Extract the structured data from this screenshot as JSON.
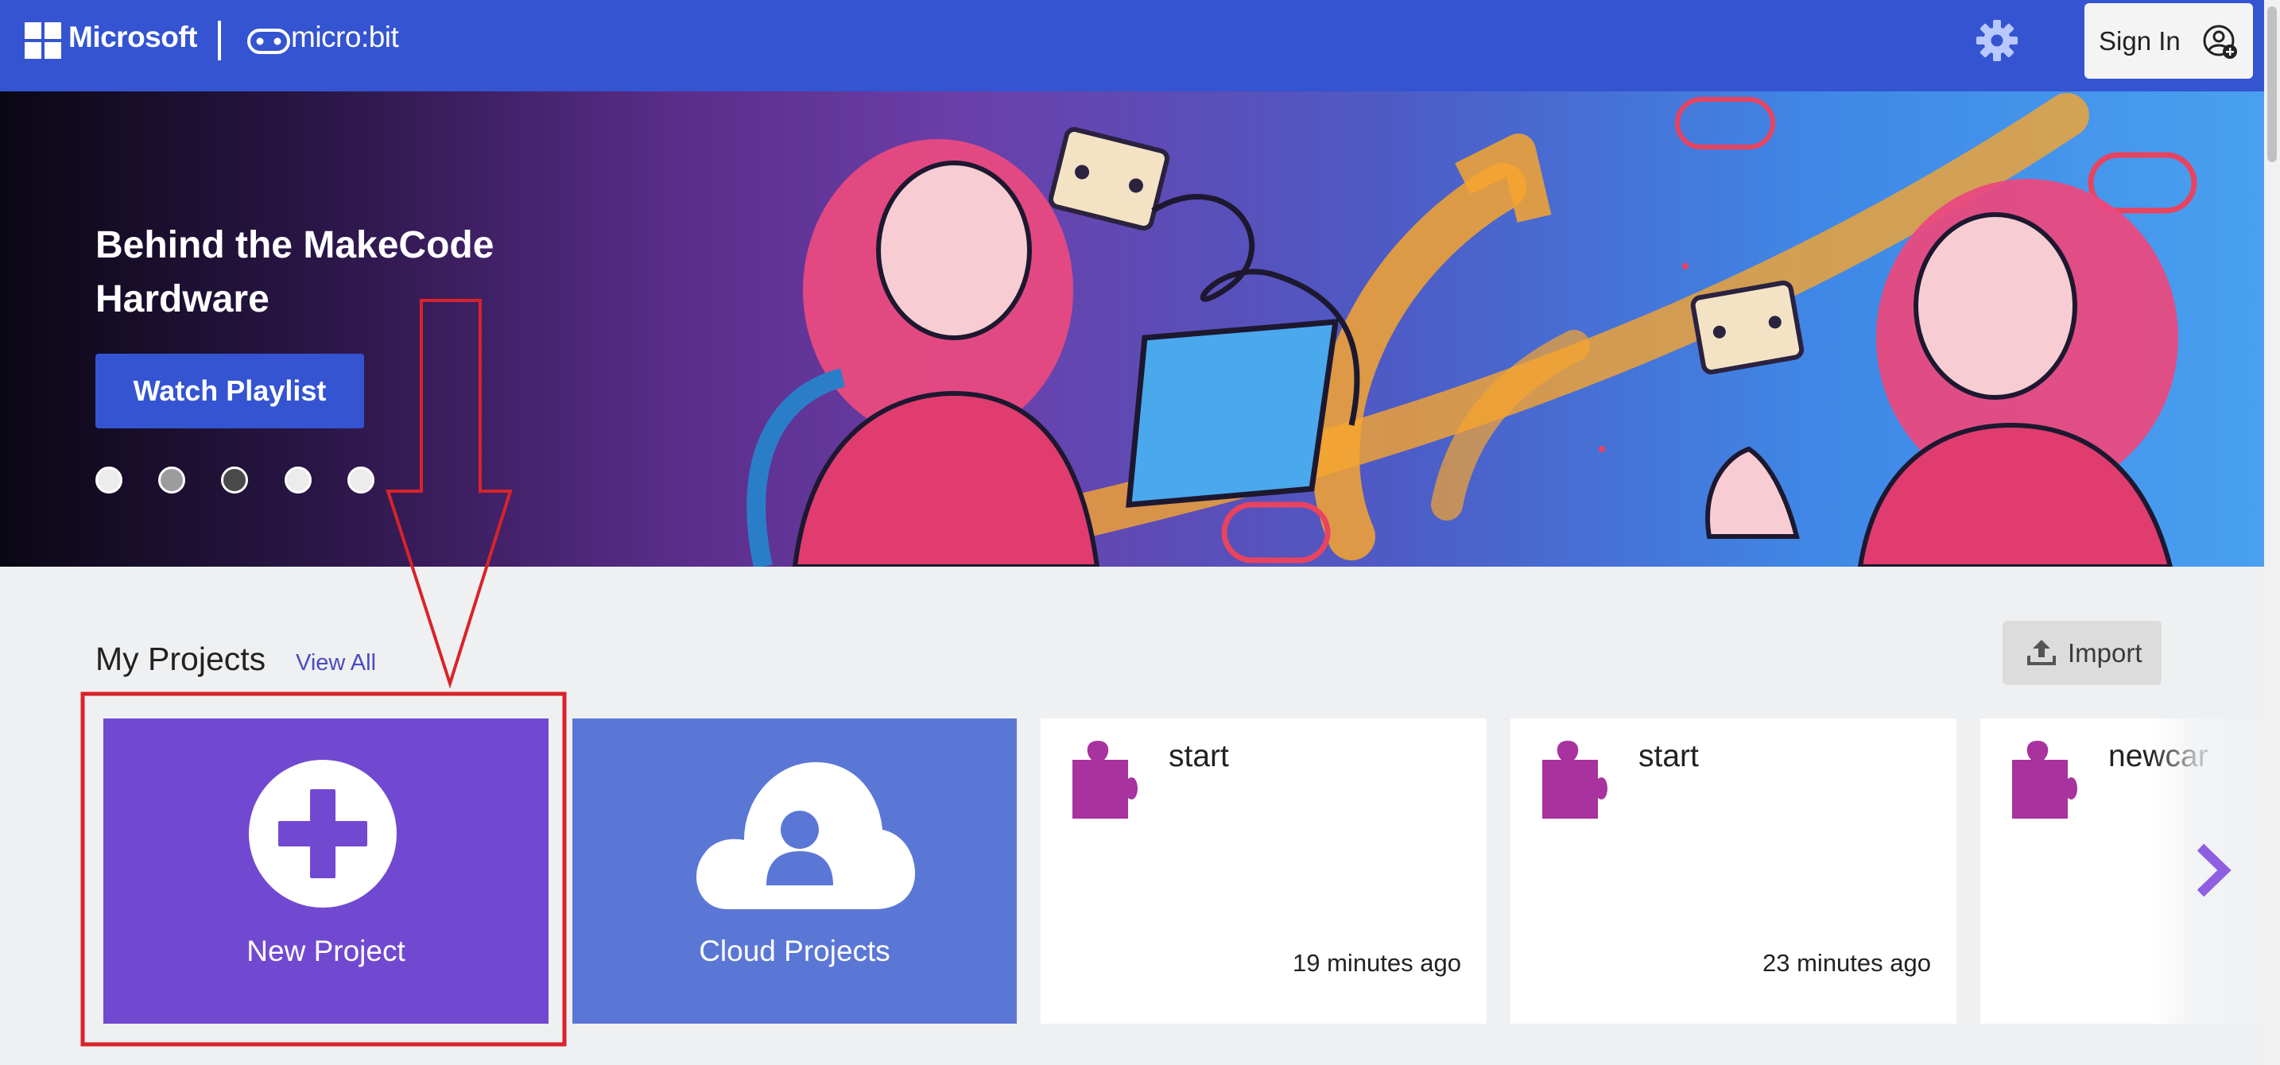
{
  "header": {
    "brand": "Microsoft",
    "product": "micro:bit",
    "sign_in_label": "Sign In",
    "settings_icon": "gear-icon",
    "account_icon": "user-plus-icon",
    "bar_color": "#3454d1"
  },
  "hero": {
    "title": "Behind the MakeCode Hardware",
    "cta_label": "Watch Playlist",
    "carousel_dots": 5,
    "active_dot": 3
  },
  "projects": {
    "section_title": "My Projects",
    "view_all_label": "View All",
    "import_label": "Import",
    "new_project_label": "New Project",
    "cloud_projects_label": "Cloud Projects",
    "items": [
      {
        "name": "start",
        "time": "19 minutes ago"
      },
      {
        "name": "start",
        "time": "23 minutes ago"
      },
      {
        "name": "newcar",
        "time": ""
      }
    ]
  },
  "colors": {
    "new_project_card": "#7149d1",
    "cloud_card": "#5b77d6",
    "puzzle_icon": "#a8329e",
    "annotation": "#d9232a"
  }
}
